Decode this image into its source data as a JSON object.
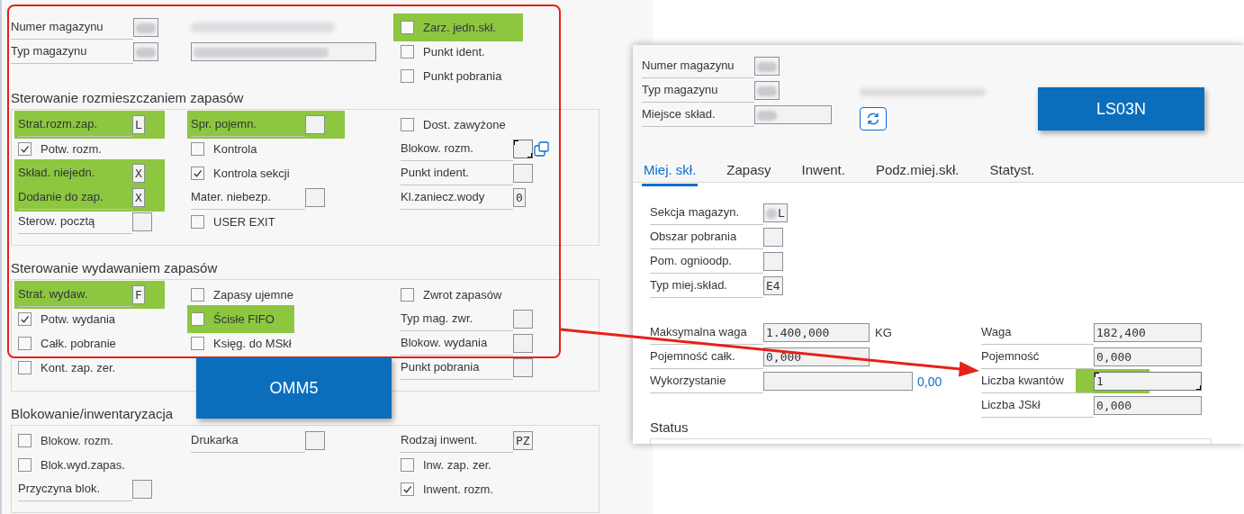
{
  "omm5": {
    "callout": "OMM5",
    "header": [
      [
        {
          "kind": "field",
          "label": "Numer magazynu",
          "blurred": true,
          "highlighted": false
        },
        {
          "kind": "field",
          "label": "Typ magazynu",
          "blurred": true,
          "highlighted": false
        }
      ],
      [
        {
          "kind": "text",
          "blurred": true,
          "highlighted": false
        },
        {
          "kind": "field",
          "blurred": true,
          "highlighted": false
        }
      ],
      [
        {
          "kind": "checkbox",
          "label": "Zarz. jedn.skł.",
          "checked": false,
          "highlighted": true
        },
        {
          "kind": "checkbox",
          "label": "Punkt ident.",
          "checked": false,
          "highlighted": false
        },
        {
          "kind": "checkbox",
          "label": "Punkt pobrania",
          "checked": false,
          "highlighted": false
        }
      ]
    ],
    "sections": [
      {
        "title": "Sterowanie rozmieszczaniem zapasów",
        "columns": [
          [
            {
              "kind": "field",
              "label": "Strat.rozm.zap.",
              "value": "L",
              "highlighted": true
            },
            {
              "kind": "checkbox",
              "label": "Potw. rozm.",
              "checked": true,
              "highlighted": false
            },
            {
              "kind": "field",
              "label": "Skład. niejedn.",
              "value": "X",
              "highlighted": true
            },
            {
              "kind": "field",
              "label": "Dodanie do zap.",
              "value": "X",
              "highlighted": true
            },
            {
              "kind": "field",
              "label": "Sterow. pocztą",
              "highlighted": false
            }
          ],
          [
            {
              "kind": "field",
              "label": "Spr. pojemn.",
              "highlighted": true
            },
            {
              "kind": "checkbox",
              "label": "Kontrola",
              "checked": false,
              "highlighted": false
            },
            {
              "kind": "checkbox",
              "label": "Kontrola sekcji",
              "checked": true,
              "highlighted": false
            },
            {
              "kind": "field",
              "label": "Mater. niebezp.",
              "highlighted": false
            },
            {
              "kind": "checkbox",
              "label": "USER EXIT",
              "checked": false,
              "highlighted": false
            }
          ],
          [
            {
              "kind": "checkbox",
              "label": "Dost. zawyżone",
              "checked": false,
              "highlighted": false
            },
            {
              "kind": "field",
              "label": "Blokow. rozm.",
              "focused": true,
              "help_icon": true,
              "highlighted": false
            },
            {
              "kind": "field",
              "label": "Punkt indent.",
              "highlighted": false
            },
            {
              "kind": "field",
              "label": "Kl.zaniecz.wody",
              "value": "0",
              "highlighted": false
            }
          ]
        ]
      },
      {
        "title": "Sterowanie wydawaniem zapasów",
        "columns": [
          [
            {
              "kind": "field",
              "label": "Strat. wydaw.",
              "value": "F",
              "highlighted": true
            },
            {
              "kind": "checkbox",
              "label": "Potw. wydania",
              "checked": true,
              "highlighted": false
            },
            {
              "kind": "checkbox",
              "label": "Całk. pobranie",
              "checked": false,
              "highlighted": false
            },
            {
              "kind": "checkbox",
              "label": "Kont. zap. zer.",
              "checked": false,
              "highlighted": false
            }
          ],
          [
            {
              "kind": "checkbox",
              "label": "Zapasy ujemne",
              "checked": false,
              "highlighted": false
            },
            {
              "kind": "checkbox",
              "label": "Ścisłe FIFO",
              "checked": false,
              "highlighted": true
            },
            {
              "kind": "checkbox",
              "label": "Księg. do MSkł",
              "checked": false,
              "highlighted": false
            }
          ],
          [
            {
              "kind": "checkbox",
              "label": "Zwrot zapasów",
              "checked": false,
              "highlighted": false
            },
            {
              "kind": "field",
              "label": "Typ mag. zwr.",
              "highlighted": false
            },
            {
              "kind": "field",
              "label": "Blokow. wydania",
              "highlighted": false
            },
            {
              "kind": "field",
              "label": "Punkt pobrania",
              "highlighted": false
            }
          ]
        ]
      },
      {
        "title": "Blokowanie/inwentaryzacja",
        "columns": [
          [
            {
              "kind": "checkbox",
              "label": "Blokow. rozm.",
              "checked": false,
              "highlighted": false
            },
            {
              "kind": "checkbox",
              "label": "Blok.wyd.zapas.",
              "checked": false,
              "highlighted": false
            },
            {
              "kind": "field",
              "label": "Przyczyna blok.",
              "highlighted": false
            }
          ],
          [
            {
              "kind": "field",
              "label": "Drukarka",
              "highlighted": false
            }
          ],
          [
            {
              "kind": "field",
              "label": "Rodzaj inwent.",
              "value": "PZ",
              "highlighted": false
            },
            {
              "kind": "checkbox",
              "label": "Inw. zap. zer.",
              "checked": false,
              "highlighted": false
            },
            {
              "kind": "checkbox",
              "label": "Inwent. rozm.",
              "checked": true,
              "highlighted": false
            }
          ]
        ]
      }
    ]
  },
  "ls03n": {
    "callout": "LS03N",
    "header": [
      {
        "label": "Numer magazynu",
        "blurred": true
      },
      {
        "label": "Typ magazynu",
        "blurred": true
      },
      {
        "label": "Miejsce skład.",
        "blurred": true
      }
    ],
    "description": {
      "blurred": true
    },
    "tabs": [
      {
        "label": "Miej. skł.",
        "selected": true
      },
      {
        "label": "Zapasy",
        "selected": false
      },
      {
        "label": "Inwent.",
        "selected": false
      },
      {
        "label": "Podz.miej.skł.",
        "selected": false
      },
      {
        "label": "Statyst.",
        "selected": false
      }
    ],
    "fields": [
      {
        "label": "Sekcja magazyn.",
        "value": "L",
        "blurred": true
      },
      {
        "label": "Obszar pobrania",
        "blurred": false
      },
      {
        "label": "Pom. ognioodp.",
        "blurred": false
      },
      {
        "label": "Typ miej.skład.",
        "value": "E4",
        "blurred": false
      }
    ],
    "left": [
      {
        "kind": "field",
        "label": "Maksymalna waga",
        "value": "1.400,000",
        "unit": "KG"
      },
      {
        "kind": "field",
        "label": "Pojemność całk.",
        "value": "0,000"
      },
      {
        "kind": "gauge",
        "label": "Wykorzystanie",
        "level": 0,
        "reading": "0,00"
      }
    ],
    "right": [
      {
        "label": "Waga",
        "value": "182,400",
        "highlighted": false,
        "focused": false
      },
      {
        "label": "Pojemność",
        "value": "0,000",
        "highlighted": false,
        "focused": false
      },
      {
        "label": "Liczba kwantów",
        "value": "1",
        "highlighted": true,
        "focused": true
      },
      {
        "label": "Liczba JSkł",
        "value": "0,000",
        "highlighted": false,
        "focused": false
      }
    ],
    "status": {
      "title": "Status"
    }
  }
}
